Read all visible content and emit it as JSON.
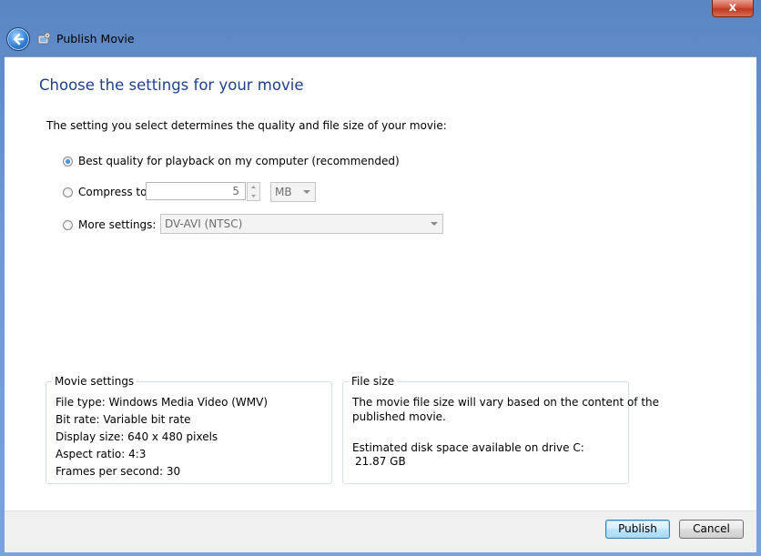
{
  "window": {
    "title": "Publish Movie",
    "close_label": "x"
  },
  "page": {
    "heading": "Choose the settings for your movie",
    "intro": "The setting you select determines the quality and file size of your movie:"
  },
  "options": {
    "best_quality_label": "Best quality for playback on my computer (recommended)",
    "compress_label": "Compress to:",
    "compress_value": "5",
    "compress_unit": "MB",
    "more_settings_label": "More settings:",
    "more_settings_value": "DV-AVI (NTSC)",
    "selected": "best_quality"
  },
  "movie_settings": {
    "legend": "Movie settings",
    "lines": [
      "File type: Windows Media Video (WMV)",
      "Bit rate: Variable bit rate",
      "Display size: 640 x 480 pixels",
      "Aspect ratio: 4:3",
      "Frames per second: 30"
    ]
  },
  "file_size": {
    "legend": "File size",
    "note_line1": "The movie file size will vary based on the content of the",
    "note_line2": "published movie.",
    "disk_label": "Estimated disk space available on drive C:",
    "disk_value": "21.87 GB"
  },
  "buttons": {
    "publish": "Publish",
    "cancel": "Cancel"
  },
  "icons": {
    "back": "back-arrow-icon",
    "app": "movie-maker-icon",
    "close": "close-icon"
  }
}
